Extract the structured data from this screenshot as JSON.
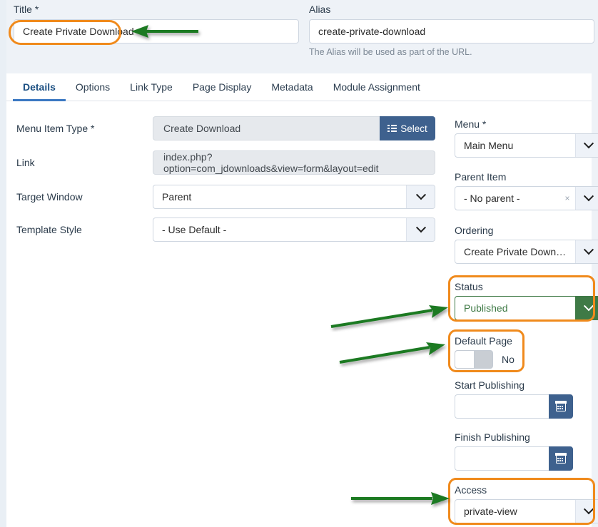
{
  "header": {
    "title_label": "Title *",
    "title_value": "Create Private Download",
    "alias_label": "Alias",
    "alias_value": "create-private-download",
    "alias_help": "The Alias will be used as part of the URL."
  },
  "tabs": [
    {
      "label": "Details",
      "active": true
    },
    {
      "label": "Options",
      "active": false
    },
    {
      "label": "Link Type",
      "active": false
    },
    {
      "label": "Page Display",
      "active": false
    },
    {
      "label": "Metadata",
      "active": false
    },
    {
      "label": "Module Assignment",
      "active": false
    }
  ],
  "left_fields": {
    "menu_item_type": {
      "label": "Menu Item Type *",
      "value": "Create Download",
      "select_button": "Select"
    },
    "link": {
      "label": "Link",
      "value": "index.php?option=com_jdownloads&view=form&layout=edit"
    },
    "target_window": {
      "label": "Target Window",
      "value": "Parent"
    },
    "template_style": {
      "label": "Template Style",
      "value": "- Use Default -"
    }
  },
  "right_fields": {
    "menu": {
      "label": "Menu *",
      "value": "Main Menu"
    },
    "parent_item": {
      "label": "Parent Item",
      "value": "- No parent -",
      "clear": "×"
    },
    "ordering": {
      "label": "Ordering",
      "value": "Create Private Download"
    },
    "status": {
      "label": "Status",
      "value": "Published"
    },
    "default_page": {
      "label": "Default Page",
      "value": "No"
    },
    "start_publishing": {
      "label": "Start Publishing",
      "value": ""
    },
    "finish_publishing": {
      "label": "Finish Publishing",
      "value": ""
    },
    "access": {
      "label": "Access",
      "value": "private-view"
    }
  },
  "annotations": {
    "highlight_color": "#f08a1c",
    "arrow_color": "#1b7a23",
    "highlighted_fields": [
      "title",
      "status",
      "default_page",
      "access"
    ],
    "arrows": [
      {
        "target": "title",
        "direction": "left"
      },
      {
        "target": "status",
        "direction": "right"
      },
      {
        "target": "default_page",
        "direction": "right"
      },
      {
        "target": "access",
        "direction": "right"
      }
    ]
  },
  "colors": {
    "band_background": "#eef2f7",
    "primary_button": "#3e618e",
    "published_green": "#3f7a46",
    "tab_accent": "#3a78c2"
  }
}
